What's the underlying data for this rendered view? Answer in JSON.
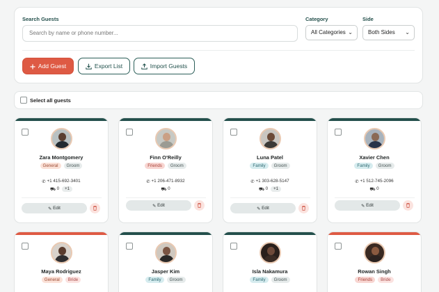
{
  "filters": {
    "search_label": "Search Guests",
    "search_placeholder": "Search by name or phone number...",
    "category_label": "Category",
    "category_value": "All Categories",
    "side_label": "Side",
    "side_value": "Both Sides"
  },
  "actions": {
    "add_label": "Add Guest",
    "export_label": "Export List",
    "import_label": "Import Guests"
  },
  "select_all_label": "Select all guests",
  "colors": {
    "accent": "#de5a44",
    "teal": "#1f4f4a",
    "bride_band": "#de5a44",
    "groom_band": "#24504c"
  },
  "guests": [
    {
      "name": "Zara Montgomery",
      "category": "General",
      "side": "Groom",
      "phone": "+1 415-692-3401",
      "cars": "0",
      "plus": "+1",
      "edit_label": "Edit"
    },
    {
      "name": "Finn O'Reilly",
      "category": "Friends",
      "side": "Groom",
      "phone": "+1 206-471-8932",
      "cars": "0",
      "plus": "",
      "edit_label": "Edit"
    },
    {
      "name": "Luna Patel",
      "category": "Family",
      "side": "Groom",
      "phone": "+1 303-628-5147",
      "cars": "0",
      "plus": "+1",
      "edit_label": "Edit"
    },
    {
      "name": "Xavier Chen",
      "category": "Family",
      "side": "Groom",
      "phone": "+1 512-745-2096",
      "cars": "0",
      "plus": "",
      "edit_label": "Edit"
    },
    {
      "name": "Maya Rodriguez",
      "category": "General",
      "side": "Bride",
      "phone": "",
      "cars": "",
      "plus": "",
      "edit_label": ""
    },
    {
      "name": "Jasper Kim",
      "category": "Family",
      "side": "Groom",
      "phone": "",
      "cars": "",
      "plus": "",
      "edit_label": ""
    },
    {
      "name": "Isla Nakamura",
      "category": "Family",
      "side": "Groom",
      "phone": "",
      "cars": "",
      "plus": "",
      "edit_label": ""
    },
    {
      "name": "Rowan Singh",
      "category": "Friends",
      "side": "Bride",
      "phone": "",
      "cars": "",
      "plus": "",
      "edit_label": ""
    }
  ]
}
